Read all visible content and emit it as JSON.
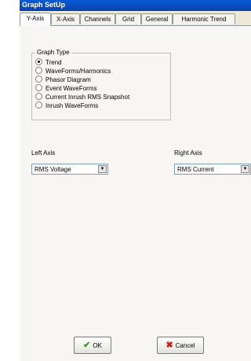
{
  "window": {
    "title": "Graph SetUp"
  },
  "tabs": [
    "Y-Axis",
    "X-Axis",
    "Channels",
    "Grid",
    "General",
    "Harmonic Trend"
  ],
  "graph_type": {
    "legend": "Graph Type",
    "options": [
      "Trend",
      "WaveForms/Harmonics",
      "Phasor Diagram",
      "Event WaveForms",
      "Current Inrush RMS Snapshot",
      "Inrush WaveForms"
    ],
    "selected": "Trend"
  },
  "left_axis": {
    "label": "Left Axis",
    "value": "RMS Voltage"
  },
  "right_axis": {
    "label": "Right Axis",
    "value": "RMS Current"
  },
  "buttons": {
    "ok": "OK",
    "cancel": "Cancel"
  },
  "icons": {
    "ok": "checkmark-icon",
    "cancel": "x-icon",
    "dropdown": "chevron-down-icon"
  }
}
